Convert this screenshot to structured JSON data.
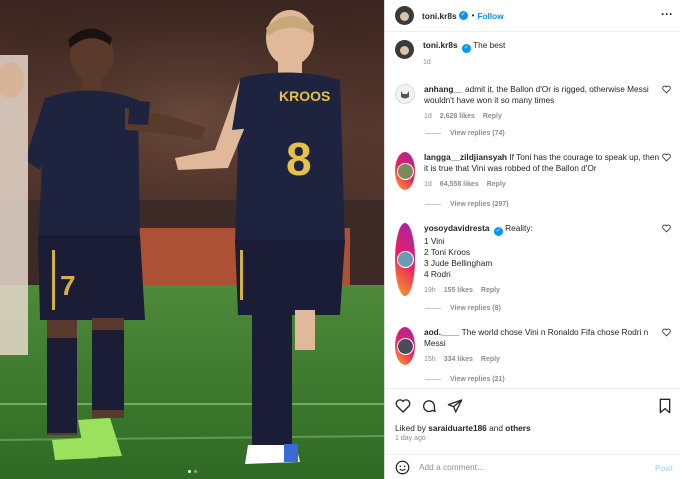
{
  "post": {
    "username": "toni.kr8s",
    "follow_label": "Follow",
    "separator": "•",
    "more_icon": "more-horizontal-icon",
    "caption": "The best",
    "caption_time": "1d",
    "shirt_name": "KROOS",
    "shirt_number": "8",
    "left_shirt_number": "7"
  },
  "comments": [
    {
      "username": "anhang__",
      "text": "admit it, the Ballon d'Or is rigged, otherwise Messi wouldn't have won it so many times",
      "time": "1d",
      "likes": "2,628 likes",
      "reply": "Reply",
      "view_replies": "View replies (74)"
    },
    {
      "username": "langga__zildjiansyah",
      "text": "If Toni has the courage to speak up, then it is true that Vini was robbed of the Ballon d'Or",
      "time": "1d",
      "likes": "64,558 likes",
      "reply": "Reply",
      "view_replies": "View replies (297)"
    },
    {
      "username": "yosoydavidresta",
      "text_lines": [
        "Reality:",
        "1 Vini",
        "2 Toni Kroos",
        "3 Jude Bellingham",
        "4 Rodri"
      ],
      "time": "19h",
      "likes": "155 likes",
      "reply": "Reply",
      "view_replies": "View replies (8)"
    },
    {
      "username": "aod.____",
      "text": "The world chose Vini n Ronaldo Fifa chose Rodri n Messi",
      "time": "15h",
      "likes": "334 likes",
      "reply": "Reply",
      "view_replies": "View replies (21)"
    }
  ],
  "footer": {
    "liked_by_prefix": "Liked by",
    "liked_by_user": "saraiduarte186",
    "liked_by_and": "and",
    "liked_by_others": "others",
    "time_ago": "1 day ago",
    "comment_placeholder": "Add a comment...",
    "post_label": "Post"
  },
  "colors": {
    "accent": "#0095f6",
    "post_disabled": "#b2dffc",
    "secondary_text": "#8e8e8e"
  }
}
